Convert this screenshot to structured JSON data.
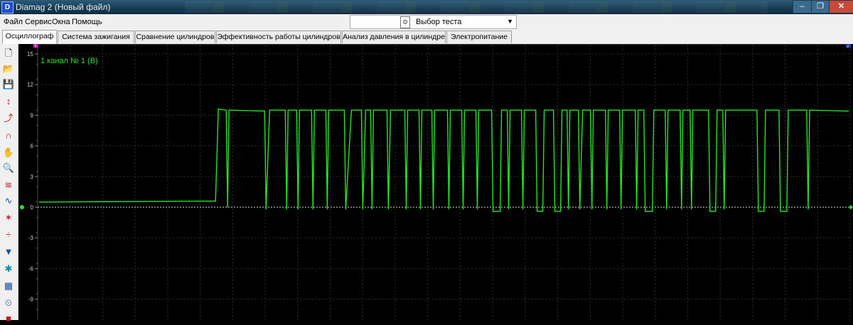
{
  "window": {
    "title": "Diamag 2 (Новый файл)",
    "app_icon": "diamag-app-icon",
    "controls": [
      "minimize-icon",
      "maximize-icon",
      "close-icon"
    ]
  },
  "menu": {
    "file": "Файл",
    "service": "Сервис",
    "windows": "Окна",
    "help": "Помощь"
  },
  "test_select": {
    "value": "Выбор теста",
    "icon": "test-document-icon"
  },
  "tabs": [
    {
      "label": "Осциллограф",
      "active": true
    },
    {
      "label": "Система зажигания"
    },
    {
      "label": "Сравнение цилиндров"
    },
    {
      "label": "Эффективность работы цилиндров"
    },
    {
      "label": "Анализ давления в цилиндре"
    },
    {
      "label": "Электропитание"
    }
  ],
  "toolbar": [
    "new-file-icon",
    "open-file-icon",
    "save-icon",
    "auto-scale-icon",
    "trigger-icon",
    "sync-icon",
    "hand-pan-icon",
    "zoom-icon",
    "overlay-waves-icon",
    "wave-compare-icon",
    "filter-icon",
    "cursor-icon",
    "color-filter-icon",
    "bug-icon",
    "table-icon",
    "auto-measure-icon",
    "stop-icon"
  ],
  "colors": {
    "trace": "#22e622",
    "background": "#000000",
    "grid": "#2e2e2e",
    "zero_line": "#d8d8d8"
  },
  "chart_data": {
    "type": "line",
    "series": [
      {
        "name": "1 канал № 1 (В)"
      }
    ],
    "ylim": [
      -11,
      15
    ],
    "yticks": [
      "15",
      "12",
      "9",
      "6",
      "3",
      "0",
      "-3",
      "-6",
      "-9"
    ],
    "grid": true,
    "levels": {
      "idle": 0.5,
      "high": 9.5,
      "low": -0.2
    },
    "transitions_x": [
      [
        0,
        0.5
      ],
      [
        232,
        0.6
      ],
      [
        248,
        0.6
      ],
      [
        252,
        9.6
      ],
      [
        263,
        9.5
      ],
      [
        265,
        0.0
      ],
      [
        267,
        9.5
      ],
      [
        317,
        9.4
      ],
      [
        319,
        -0.2
      ],
      [
        324,
        9.5
      ],
      [
        346,
        9.5
      ],
      [
        348,
        -0.2
      ],
      [
        350,
        9.5
      ],
      [
        362,
        9.5
      ],
      [
        364,
        -0.2
      ],
      [
        366,
        9.5
      ],
      [
        383,
        9.5
      ],
      [
        385,
        -0.2
      ],
      [
        387,
        9.5
      ],
      [
        403,
        9.5
      ],
      [
        405,
        -0.2
      ],
      [
        407,
        9.5
      ],
      [
        429,
        9.5
      ],
      [
        431,
        -0.2
      ],
      [
        439,
        9.5
      ],
      [
        453,
        9.5
      ],
      [
        455,
        -0.2
      ],
      [
        459,
        9.5
      ],
      [
        466,
        9.5
      ],
      [
        468,
        -0.2
      ],
      [
        470,
        9.5
      ],
      [
        489,
        9.5
      ],
      [
        491,
        -0.2
      ],
      [
        494,
        9.5
      ],
      [
        514,
        9.5
      ],
      [
        516,
        -0.2
      ],
      [
        518,
        9.5
      ],
      [
        534,
        9.5
      ],
      [
        536,
        -0.2
      ],
      [
        538,
        9.5
      ],
      [
        552,
        9.5
      ],
      [
        554,
        -0.2
      ],
      [
        556,
        9.5
      ],
      [
        574,
        9.5
      ],
      [
        576,
        -0.2
      ],
      [
        578,
        9.5
      ],
      [
        594,
        9.5
      ],
      [
        596,
        -0.2
      ],
      [
        598,
        9.5
      ],
      [
        614,
        9.5
      ],
      [
        616,
        -0.2
      ],
      [
        618,
        9.5
      ],
      [
        636,
        9.5
      ],
      [
        638,
        -0.4
      ],
      [
        648,
        -0.4
      ],
      [
        650,
        9.5
      ],
      [
        658,
        9.5
      ],
      [
        660,
        -0.2
      ],
      [
        662,
        9.5
      ],
      [
        678,
        9.5
      ],
      [
        680,
        -0.2
      ],
      [
        682,
        9.5
      ],
      [
        698,
        9.5
      ],
      [
        700,
        -0.4
      ],
      [
        708,
        -0.4
      ],
      [
        710,
        9.5
      ],
      [
        723,
        9.5
      ],
      [
        725,
        -0.4
      ],
      [
        733,
        -0.4
      ],
      [
        735,
        9.5
      ],
      [
        742,
        9.5
      ],
      [
        744,
        -0.2
      ],
      [
        746,
        9.5
      ],
      [
        758,
        9.5
      ],
      [
        760,
        -0.2
      ],
      [
        764,
        9.5
      ],
      [
        775,
        9.5
      ],
      [
        777,
        -0.2
      ],
      [
        779,
        9.5
      ],
      [
        796,
        9.5
      ],
      [
        798,
        -0.2
      ],
      [
        800,
        9.5
      ],
      [
        816,
        9.5
      ],
      [
        818,
        -0.2
      ],
      [
        820,
        9.5
      ],
      [
        838,
        9.5
      ],
      [
        840,
        -0.2
      ],
      [
        842,
        9.5
      ],
      [
        850,
        9.5
      ],
      [
        852,
        -0.4
      ],
      [
        862,
        -0.4
      ],
      [
        864,
        9.5
      ],
      [
        880,
        9.5
      ],
      [
        882,
        -0.2
      ],
      [
        884,
        9.5
      ],
      [
        901,
        9.5
      ],
      [
        903,
        -0.2
      ],
      [
        905,
        9.5
      ],
      [
        915,
        9.5
      ],
      [
        917,
        -0.2
      ],
      [
        919,
        9.5
      ],
      [
        941,
        9.5
      ],
      [
        943,
        -0.4
      ],
      [
        951,
        -0.4
      ],
      [
        953,
        9.5
      ],
      [
        961,
        9.5
      ],
      [
        963,
        -0.2
      ],
      [
        965,
        9.5
      ],
      [
        1009,
        9.5
      ],
      [
        1011,
        -0.4
      ],
      [
        1019,
        -0.4
      ],
      [
        1021,
        9.5
      ],
      [
        1040,
        9.5
      ],
      [
        1042,
        -0.4
      ],
      [
        1051,
        -0.4
      ],
      [
        1053,
        9.5
      ],
      [
        1079,
        9.5
      ],
      [
        1081,
        -0.2
      ],
      [
        1083,
        9.5
      ],
      [
        1138,
        9.4
      ]
    ],
    "x_units": "samples",
    "cursor_markers": [
      "1",
      "2"
    ]
  }
}
